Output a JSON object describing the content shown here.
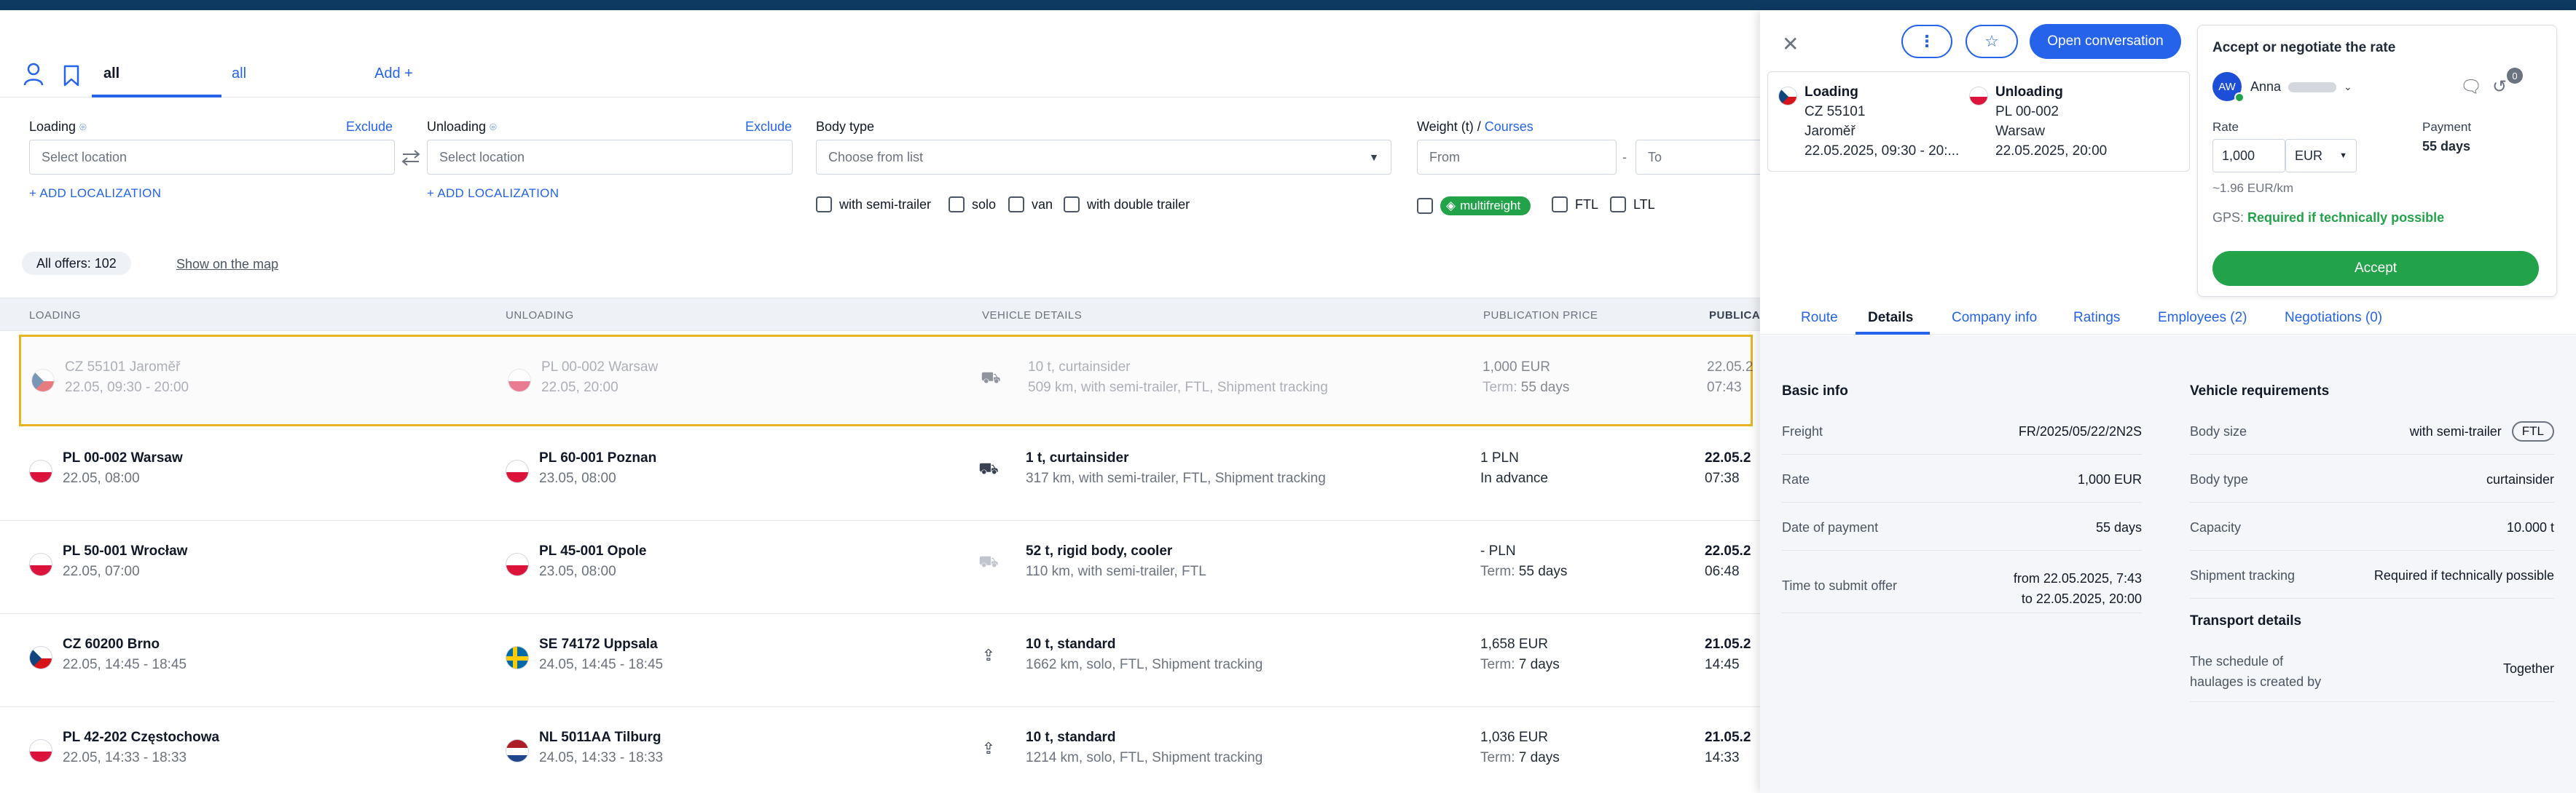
{
  "tabs": {
    "active_label": "all",
    "second_label": "all",
    "add_label": "Add +"
  },
  "filters": {
    "loading": {
      "label": "Loading",
      "exclude": "Exclude",
      "placeholder": "Select location",
      "add": "+ ADD LOCALIZATION"
    },
    "unloading": {
      "label": "Unloading",
      "exclude": "Exclude",
      "placeholder": "Select location",
      "add": "+ ADD LOCALIZATION"
    },
    "body_type": {
      "label": "Body type",
      "placeholder": "Choose from list",
      "options": [
        "with semi-trailer",
        "solo",
        "van",
        "with double trailer"
      ]
    },
    "weight": {
      "label": "Weight (t) /",
      "courses": "Courses",
      "from": "From",
      "dash": "-",
      "to": "To",
      "options": [
        "multifreight",
        "FTL",
        "LTL"
      ]
    }
  },
  "offers": {
    "label": "All offers:",
    "count": "102",
    "map_link": "Show on the map"
  },
  "table": {
    "headers": [
      "LOADING",
      "UNLOADING",
      "VEHICLE DETAILS",
      "PUBLICATION PRICE",
      "PUBLICA"
    ],
    "rows": [
      {
        "load_city": "CZ 55101 Jaroměř",
        "load_time": "22.05, 09:30 - 20:00",
        "unload_city": "PL 00-002 Warsaw",
        "unload_time": "22.05, 20:00",
        "vehicle": "10 t, curtainsider",
        "vehicle_sub": "509 km, with semi-trailer, FTL, Shipment tracking",
        "price": "1,000 EUR",
        "term_label": "Term:",
        "term": "55 days",
        "pub_date": "22.05.2",
        "pub_time": "07:43",
        "load_flag": "cz",
        "unload_flag": "pl",
        "vehicle_icon": "truck-icon"
      },
      {
        "load_city": "PL 00-002 Warsaw",
        "load_time": "22.05, 08:00",
        "unload_city": "PL 60-001 Poznan",
        "unload_time": "23.05, 08:00",
        "vehicle": "1 t, curtainsider",
        "vehicle_sub": "317 km, with semi-trailer, FTL, Shipment tracking",
        "price": "1 PLN",
        "term_label": "",
        "term": "In advance",
        "pub_date": "22.05.2",
        "pub_time": "07:38",
        "load_flag": "pl",
        "unload_flag": "pl",
        "vehicle_icon": "truck-icon"
      },
      {
        "load_city": "PL 50-001 Wrocław",
        "load_time": "22.05, 07:00",
        "unload_city": "PL 45-001 Opole",
        "unload_time": "23.05, 08:00",
        "vehicle": "52 t, rigid body, cooler",
        "vehicle_sub": "110 km, with semi-trailer, FTL",
        "price": "- PLN",
        "term_label": "Term:",
        "term": "55 days",
        "pub_date": "22.05.2",
        "pub_time": "06:48",
        "load_flag": "pl",
        "unload_flag": "pl",
        "vehicle_icon": "rigid-truck-icon"
      },
      {
        "load_city": "CZ 60200 Brno",
        "load_time": "22.05, 14:45 - 18:45",
        "unload_city": "SE 74172 Uppsala",
        "unload_time": "24.05, 14:45 - 18:45",
        "vehicle": "10 t, standard",
        "vehicle_sub": "1662 km, solo, FTL, Shipment tracking",
        "price": "1,658 EUR",
        "term_label": "Term:",
        "term": "7 days",
        "pub_date": "21.05.2",
        "pub_time": "14:45",
        "load_flag": "cz",
        "unload_flag": "se",
        "vehicle_icon": "upload-icon"
      },
      {
        "load_city": "PL 42-202 Częstochowa",
        "load_time": "22.05, 14:33 - 18:33",
        "unload_city": "NL 5011AA Tilburg",
        "unload_time": "24.05, 14:33 - 18:33",
        "vehicle": "10 t, standard",
        "vehicle_sub": "1214 km, solo, FTL, Shipment tracking",
        "price": "1,036 EUR",
        "term_label": "Term:",
        "term": "7 days",
        "pub_date": "21.05.2",
        "pub_time": "14:33",
        "load_flag": "pl",
        "unload_flag": "nl",
        "vehicle_icon": "upload-icon"
      }
    ]
  },
  "panel": {
    "open_conversation": "Open conversation",
    "loading": {
      "title": "Loading",
      "code": "CZ 55101",
      "city": "Jaroměř",
      "date": "22.05.2025, 09:30 - 20:..."
    },
    "unloading": {
      "title": "Unloading",
      "code": "PL 00-002",
      "city": "Warsaw",
      "date": "22.05.2025, 20:00"
    },
    "rate": {
      "title": "Accept or negotiate the rate",
      "initials": "AW",
      "name": "Anna",
      "badge": "0",
      "rate_label": "Rate",
      "rate_value": "1,000",
      "currency": "EUR",
      "per_km": "~1.96 EUR/km",
      "payment_label": "Payment",
      "payment_value": "55 days",
      "gps_label": "GPS:",
      "gps_value": "Required if technically possible",
      "accept": "Accept"
    },
    "tabs": [
      "Route",
      "Details",
      "Company info",
      "Ratings",
      "Employees (2)",
      "Negotiations (0)"
    ],
    "basic_info": {
      "title": "Basic info",
      "rows": [
        {
          "label": "Freight",
          "value": "FR/2025/05/22/2N2S"
        },
        {
          "label": "Rate",
          "value": "1,000 EUR"
        },
        {
          "label": "Date of payment",
          "value": "55 days"
        },
        {
          "label": "Time to submit offer",
          "value": "from 22.05.2025, 7:43",
          "value2": "to 22.05.2025, 20:00"
        }
      ]
    },
    "vehicle_req": {
      "title": "Vehicle requirements",
      "rows": [
        {
          "label": "Body size",
          "value": "with semi-trailer",
          "tag": "FTL"
        },
        {
          "label": "Body type",
          "value": "curtainsider"
        },
        {
          "label": "Capacity",
          "value": "10.000 t"
        },
        {
          "label": "Shipment tracking",
          "value": "Required if technically possible"
        }
      ]
    },
    "transport": {
      "title": "Transport details",
      "label_line1": "The schedule of",
      "label_line2": "haulages is created by",
      "value": "Together"
    }
  },
  "colors": {
    "accent": "#2563eb",
    "green": "#22a34a",
    "selected_border": "#e6b422",
    "topbar": "#0e3a62"
  }
}
